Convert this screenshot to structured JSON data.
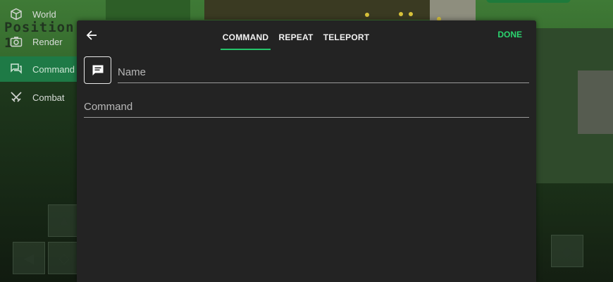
{
  "side_menu": {
    "position_text": "Position: 1",
    "items": [
      {
        "label": "World",
        "icon": "cube-icon",
        "active": false
      },
      {
        "label": "Render",
        "icon": "camera-icon",
        "active": false
      },
      {
        "label": "Command",
        "icon": "chat-icon",
        "active": true
      },
      {
        "label": "Combat",
        "icon": "crossed-swords-icon",
        "active": false
      }
    ]
  },
  "dialog": {
    "back_icon": "arrow-left-icon",
    "tabs": [
      {
        "label": "COMMAND",
        "active": true
      },
      {
        "label": "REPEAT",
        "active": false
      },
      {
        "label": "TELEPORT",
        "active": false
      }
    ],
    "done_label": "DONE",
    "message_icon": "message-icon",
    "name_field": {
      "placeholder": "Name",
      "value": ""
    },
    "command_field": {
      "placeholder": "Command",
      "value": ""
    }
  },
  "colors": {
    "accent": "#2bd46f",
    "active_menu": "#1e7a46",
    "dialog_bg": "#232323"
  }
}
